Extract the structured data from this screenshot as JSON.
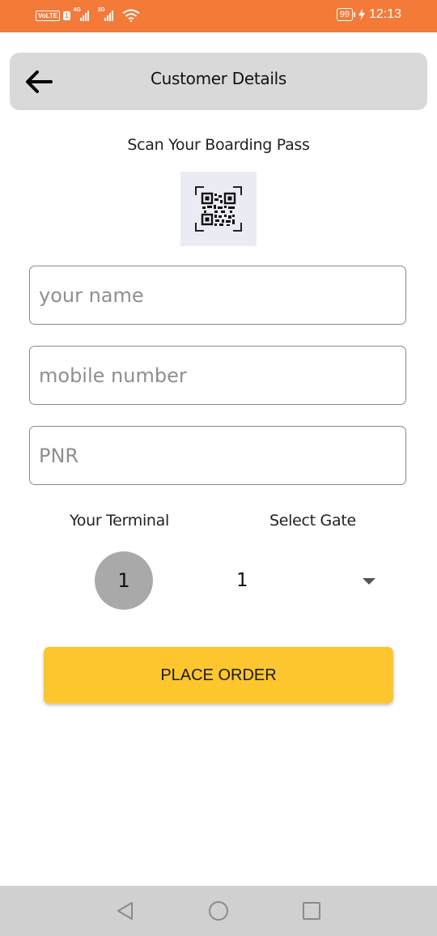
{
  "status_bar": {
    "volte": "VoLTE",
    "sim1": "1",
    "network1_type": "4G",
    "network2_type": "3G",
    "battery": "99",
    "time": "12:13"
  },
  "header": {
    "title": "Customer Details",
    "back_icon": "arrow-left-icon"
  },
  "scan": {
    "label": "Scan Your Boarding Pass",
    "icon": "qr-code-scan-icon"
  },
  "form": {
    "name_placeholder": "your name",
    "mobile_placeholder": "mobile number",
    "pnr_placeholder": "PNR"
  },
  "terminal": {
    "label": "Your Terminal",
    "value": "1"
  },
  "gate": {
    "label": "Select Gate",
    "selected": "1"
  },
  "actions": {
    "place_order": "PLACE ORDER"
  },
  "nav_bar": {
    "back_icon": "nav-back-triangle-icon",
    "home_icon": "nav-home-circle-icon",
    "recents_icon": "nav-recents-square-icon"
  },
  "colors": {
    "status_bar": "#f47a3a",
    "header_bg": "#d9d9d9",
    "qr_bg": "#ebebf3",
    "terminal_badge": "#a9a9a9",
    "primary_button": "#fdc62f",
    "nav_bar": "#d0d0d0"
  }
}
